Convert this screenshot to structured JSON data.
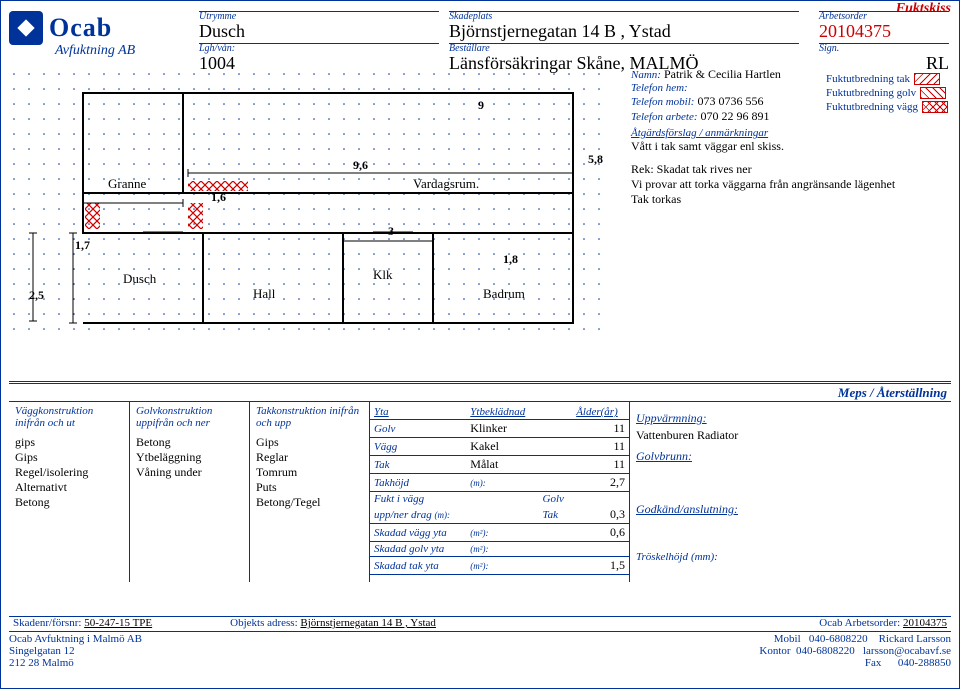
{
  "title_top": "Fuktskiss",
  "logo": {
    "name": "Ocab",
    "sub": "Avfuktning AB"
  },
  "header": {
    "utrymme": {
      "label": "Utrymme",
      "value": "Dusch"
    },
    "lgh": {
      "label": "Lgh/vån:",
      "value": "1004"
    },
    "skadeplats": {
      "label": "Skadeplats",
      "value": "Björnstjernegatan 14 B , Ystad"
    },
    "bestallare": {
      "label": "Beställare",
      "value": "Länsförsäkringar Skåne, MALMÖ"
    },
    "arbetsorder": {
      "label": "Arbetsorder",
      "value": "20104375"
    },
    "sign": {
      "label": "Sign.",
      "value": "RL"
    }
  },
  "info": {
    "namn_label": "Namn:",
    "namn": "Patrik & Cecilia Hartlen",
    "tel_hem": "Telefon hem:",
    "tel_mob_label": "Telefon mobil:",
    "tel_mob": "073 0736 556",
    "tel_arb_label": "Telefon arbete:",
    "tel_arb": "070 22 96 891",
    "atg_head": "Åtgärdsförslag / anmärkningar",
    "atg_1": "Vått i tak samt väggar enl skiss.",
    "atg_2": "Rek: Skadat tak rives ner",
    "atg_3": "Vi provar att torka väggarna från angränsande lägenhet",
    "atg_4": "Tak torkas"
  },
  "legend": {
    "tak": "Fuktutbredning tak",
    "golv": "Fuktutbredning golv",
    "vagg": "Fuktutbredning vägg"
  },
  "plan": {
    "dim96": "9,6",
    "dim16": "1,6",
    "dim17": "1,7",
    "dim25": "2,5",
    "dim9": "9",
    "dim58": "5,8",
    "dim3": "3",
    "dim18": "1,8",
    "r_granne": "Granne",
    "r_vardag": "Vardagsrum.",
    "r_dusch": "Dusch",
    "r_hall": "Hall",
    "r_klk": "Klk",
    "r_badrum": "Badrum"
  },
  "meps": "Meps / Återställning",
  "cols": {
    "c1": {
      "h": "Väggkonstruktion\ninifrån och ut",
      "items": [
        "gips",
        "Gips",
        "Regel/isolering",
        "Alternativt",
        "Betong"
      ]
    },
    "c2": {
      "h": "Golvkonstruktion\nuppifrån och ner",
      "items": [
        "Betong",
        "Ytbeläggning",
        "Våning under"
      ]
    },
    "c3": {
      "h": "Takkonstruktion\ninifrån och upp",
      "items": [
        "Gips",
        "Reglar",
        "Tomrum",
        "Puts",
        "Betong/Tegel"
      ]
    }
  },
  "yta": {
    "h_yta": "Yta",
    "h_ytb": "Ytbeklädnad",
    "h_ald": "Ålder(år)",
    "golv": "Golv",
    "golv_m": "Klinker",
    "golv_a": "11",
    "vagg": "Vägg",
    "vagg_m": "Kakel",
    "vagg_a": "11",
    "tak": "Tak",
    "tak_m": "Målat",
    "tak_a": "11",
    "takhojd": "Takhöjd",
    "takhojd_u": "(m):",
    "takhojd_v": "2,7",
    "fukt": "Fukt i vägg",
    "fukt_g": "Golv",
    "drag": "upp/ner drag",
    "drag_u": "(m):",
    "drag_v1": "Tak",
    "drag_v": "0,3",
    "skv": "Skadad vägg yta",
    "skv_u": "(m²):",
    "skv_v": "0,6",
    "skg": "Skadad golv yta",
    "skg_u": "(m²):",
    "skt": "Skadad tak yta",
    "skt_u": "(m²):",
    "skt_v": "1,5"
  },
  "right": {
    "uppv_h": "Uppvärmning:",
    "uppv_v": "Vattenburen Radiator",
    "golvb_h": "Golvbrunn:",
    "godk_h": "Godkänd/anslutning:",
    "trosk_h": "Tröskelhöjd",
    "trosk_u": "(mm):"
  },
  "footbar": {
    "skad_l": "Skadenr/försnr:",
    "skad_v": "50-247-15 TPE",
    "obj_l": "Objekts adress:",
    "obj_v": "Björnstjernegatan 14 B , Ystad",
    "arb_l": "Ocab Arbetsorder:",
    "arb_v": "20104375"
  },
  "footer": {
    "company": "Ocab Avfuktning i Malmö AB",
    "addr1": "Singelgatan 12",
    "addr2": "212 28 Malmö",
    "m_l": "Mobil",
    "m_v": "040-6808220",
    "m_n": "Rickard Larsson",
    "k_l": "Kontor",
    "k_v": "040-6808220",
    "k_e": "larsson@ocabavf.se",
    "f_l": "Fax",
    "f_v": "040-288850"
  }
}
